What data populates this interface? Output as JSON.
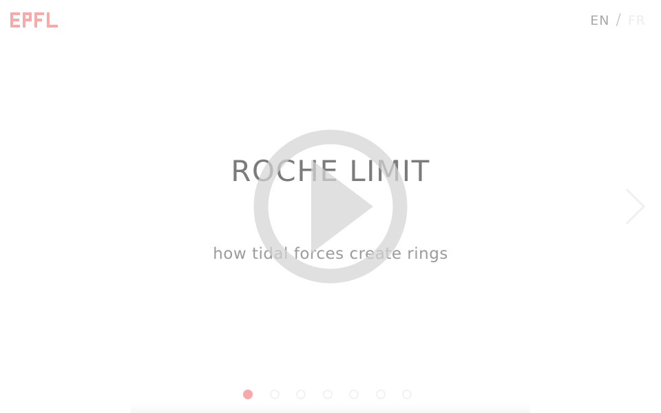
{
  "header": {
    "logo_text": "EPFL",
    "language": {
      "en_label": "EN",
      "separator": "/",
      "fr_label": "FR",
      "active": "EN"
    }
  },
  "slide": {
    "title": "ROCHE LIMIT",
    "subtitle": "how tidal forces create rings"
  },
  "controls": {
    "play_icon": "play-circle-icon",
    "next_icon": "chevron-right-icon"
  },
  "pagination": {
    "total": 7,
    "current": 1
  },
  "colors": {
    "brand": "#f8a9a9",
    "title": "#7b7b7b",
    "subtitle": "#9b9b9b",
    "play_overlay": "#d8d8d8"
  }
}
